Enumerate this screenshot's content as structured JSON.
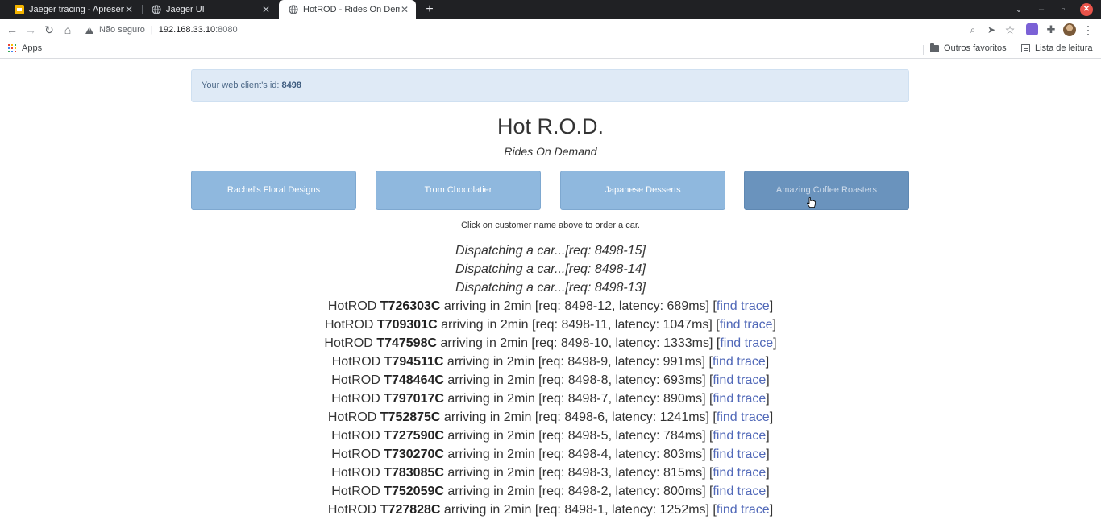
{
  "browser": {
    "tabs": [
      {
        "title": "Jaeger tracing - Apresent",
        "active": false,
        "favicon": "slides-icon"
      },
      {
        "title": "Jaeger UI",
        "active": false,
        "favicon": "globe-icon"
      },
      {
        "title": "HotROD - Rides On Dema",
        "active": true,
        "favicon": "globe-icon"
      }
    ],
    "new_tab": "+",
    "address": {
      "security": "Não seguro",
      "host": "192.168.33.10",
      "port": ":8080"
    },
    "bookmarks": {
      "apps": "Apps",
      "other": "Outros favoritos",
      "reading_list": "Lista de leitura"
    }
  },
  "page": {
    "client_id_label": "Your web client's id:",
    "client_id": "8498",
    "title": "Hot R.O.D.",
    "subtitle": "Rides On Demand",
    "customers": [
      "Rachel's Floral Designs",
      "Trom Chocolatier",
      "Japanese Desserts",
      "Amazing Coffee Roasters"
    ],
    "hint": "Click on customer name above to order a car.",
    "dispatching": [
      "Dispatching a car...[req: 8498-15]",
      "Dispatching a car...[req: 8498-14]",
      "Dispatching a car...[req: 8498-13]"
    ],
    "rides": [
      {
        "car": "T726303C",
        "req": "8498-12",
        "latency": "689ms"
      },
      {
        "car": "T709301C",
        "req": "8498-11",
        "latency": "1047ms"
      },
      {
        "car": "T747598C",
        "req": "8498-10",
        "latency": "1333ms"
      },
      {
        "car": "T794511C",
        "req": "8498-9",
        "latency": "991ms"
      },
      {
        "car": "T748464C",
        "req": "8498-8",
        "latency": "693ms"
      },
      {
        "car": "T797017C",
        "req": "8498-7",
        "latency": "890ms"
      },
      {
        "car": "T752875C",
        "req": "8498-6",
        "latency": "1241ms"
      },
      {
        "car": "T727590C",
        "req": "8498-5",
        "latency": "784ms"
      },
      {
        "car": "T730270C",
        "req": "8498-4",
        "latency": "803ms"
      },
      {
        "car": "T783085C",
        "req": "8498-3",
        "latency": "815ms"
      },
      {
        "car": "T752059C",
        "req": "8498-2",
        "latency": "800ms"
      },
      {
        "car": "T727828C",
        "req": "8498-1",
        "latency": "1252ms"
      }
    ],
    "ride_prefix": "HotROD",
    "ride_eta": "arriving in 2min",
    "req_label": "req:",
    "latency_label": "latency:",
    "find_trace": "find trace"
  },
  "colors": {
    "customer_button": "#8fb8de",
    "customer_button_hover": "#6a93bd",
    "link": "#5068b8",
    "alert_bg": "#dfeaf6"
  }
}
